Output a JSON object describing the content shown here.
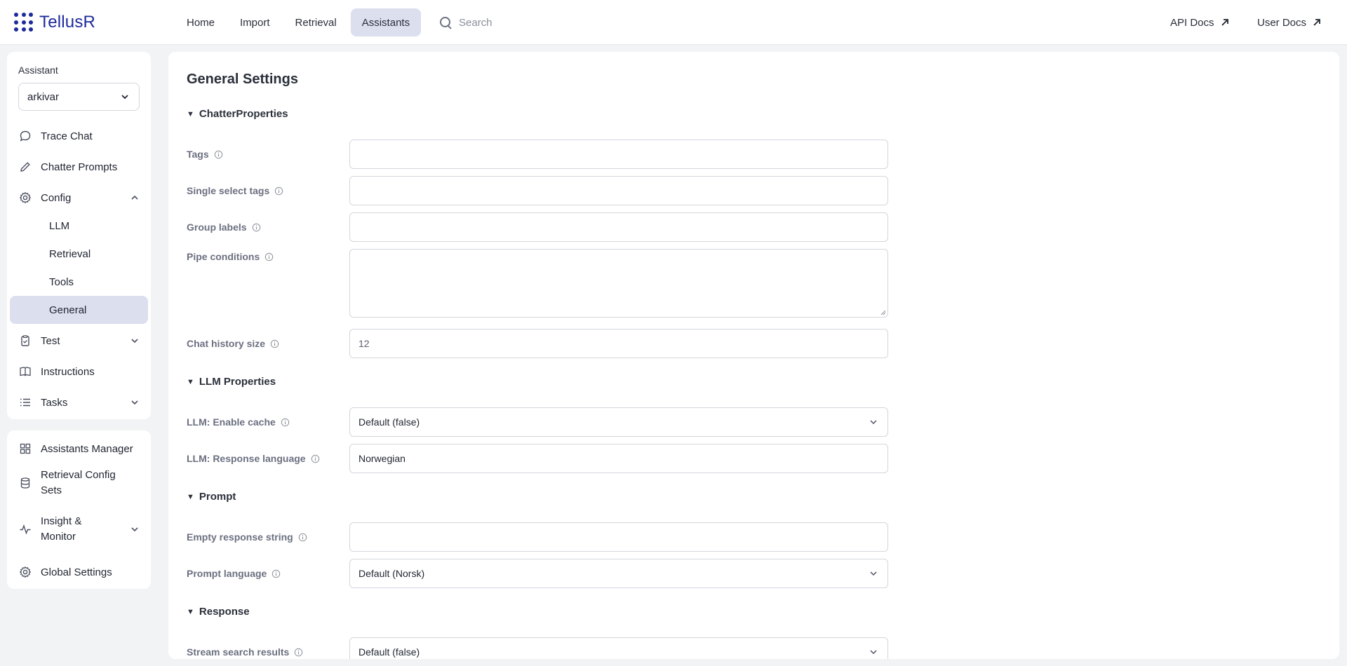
{
  "app": {
    "name": "TellusR"
  },
  "nav": {
    "items": [
      {
        "label": "Home"
      },
      {
        "label": "Import"
      },
      {
        "label": "Retrieval"
      },
      {
        "label": "Assistants"
      }
    ],
    "search_placeholder": "Search",
    "api_docs": "API Docs",
    "user_docs": "User Docs"
  },
  "sidebar": {
    "assistant_label": "Assistant",
    "assistant_value": "arkivar",
    "items": {
      "trace_chat": "Trace Chat",
      "chatter_prompts": "Chatter Prompts",
      "config": "Config",
      "llm": "LLM",
      "retrieval": "Retrieval",
      "tools": "Tools",
      "general": "General",
      "test": "Test",
      "instructions": "Instructions",
      "tasks": "Tasks"
    },
    "bottom": {
      "assistants_manager": "Assistants Manager",
      "retrieval_config_sets_1": "Retrieval Config",
      "retrieval_config_sets_2": "Sets",
      "insight_monitor_1": "Insight &",
      "insight_monitor_2": "Monitor",
      "global_settings": "Global Settings"
    }
  },
  "main": {
    "title": "General Settings",
    "sections": {
      "chatter": "ChatterProperties",
      "llm": "LLM Properties",
      "prompt": "Prompt",
      "response": "Response"
    },
    "fields": {
      "tags": {
        "label": "Tags",
        "value": ""
      },
      "single_select_tags": {
        "label": "Single select tags",
        "value": ""
      },
      "group_labels": {
        "label": "Group labels",
        "value": ""
      },
      "pipe_conditions": {
        "label": "Pipe conditions",
        "value": ""
      },
      "chat_history_size": {
        "label": "Chat history size",
        "value": "12"
      },
      "enable_cache": {
        "label": "LLM: Enable cache",
        "value": "Default (false)"
      },
      "response_language": {
        "label": "LLM: Response language",
        "value": "Norwegian"
      },
      "empty_response": {
        "label": "Empty response string",
        "value": ""
      },
      "prompt_language": {
        "label": "Prompt language",
        "value": "Default (Norsk)"
      },
      "stream_search": {
        "label": "Stream search results",
        "value": "Default (false)"
      }
    }
  }
}
